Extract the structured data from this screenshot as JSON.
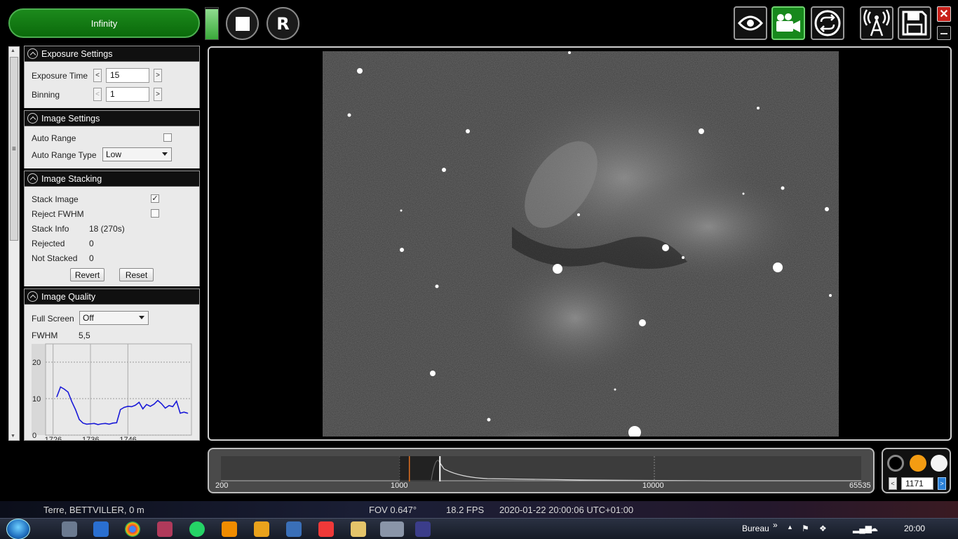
{
  "toolbar": {
    "profile_label": "Infinity",
    "record_label": "R",
    "signal_level": 0.95
  },
  "exposure": {
    "title": "Exposure Settings",
    "exposure_time_label": "Exposure Time",
    "exposure_time_value": "15",
    "binning_label": "Binning",
    "binning_value": "1",
    "decrement": "<",
    "increment": ">"
  },
  "image_settings": {
    "title": "Image Settings",
    "auto_range_label": "Auto Range",
    "auto_range_checked": false,
    "auto_range_type_label": "Auto Range Type",
    "auto_range_type_value": "Low"
  },
  "stacking": {
    "title": "Image Stacking",
    "stack_image_label": "Stack Image",
    "stack_image_checked": true,
    "reject_fwhm_label": "Reject FWHM",
    "reject_fwhm_checked": false,
    "stack_info_label": "Stack Info",
    "stack_info_value": "18 (270s)",
    "rejected_label": "Rejected",
    "rejected_value": "0",
    "not_stacked_label": "Not Stacked",
    "not_stacked_value": "0",
    "revert_label": "Revert",
    "reset_label": "Reset"
  },
  "quality": {
    "title": "Image Quality",
    "full_screen_label": "Full Screen",
    "full_screen_value": "Off",
    "fwhm_label": "FWHM",
    "fwhm_value": "5,5"
  },
  "chart_data": {
    "type": "line",
    "title": "",
    "xlabel": "",
    "ylabel": "",
    "ylim": [
      0,
      25
    ],
    "yticks": [
      "0",
      "10",
      "20"
    ],
    "xticks": [
      "1726",
      "1736",
      "1746"
    ],
    "x": [
      1727,
      1728,
      1729,
      1730,
      1731,
      1732,
      1733,
      1734,
      1735,
      1736,
      1737,
      1738,
      1739,
      1740,
      1741,
      1742,
      1743,
      1744,
      1745,
      1746,
      1747,
      1748,
      1749,
      1750,
      1751,
      1752,
      1753,
      1754,
      1755,
      1756,
      1757,
      1758,
      1759,
      1760,
      1761,
      1762
    ],
    "series": [
      {
        "values": [
          10.5,
          13.2,
          12.6,
          11.8,
          9.2,
          7,
          4.3,
          3.3,
          3,
          3.1,
          3.2,
          2.9,
          3.1,
          3.2,
          3,
          3.3,
          3.4,
          7,
          7.6,
          7.9,
          7.8,
          8.2,
          9,
          7.2,
          8.4,
          7.9,
          8.5,
          9.5,
          8.6,
          7.4,
          8.1,
          7.8,
          9.3,
          6,
          6.3,
          6
        ],
        "color": "#1a1ad8"
      }
    ],
    "grid": true
  },
  "histogram": {
    "min_label": "200",
    "tick_1000": "1000",
    "tick_10000": "10000",
    "max_label": "65535",
    "black_point": 1100,
    "white_point": 1450
  },
  "color_panel": {
    "prev_label": "<",
    "next_label": ">",
    "frame_value": "1171"
  },
  "status": {
    "location": "Terre, BETTVILLER, 0 m",
    "fov": "FOV 0.647°",
    "fps": "18.2 FPS",
    "datetime": "2020-01-22 20:00:06 UTC+01:00"
  },
  "taskbar": {
    "bureau_label": "Bureau",
    "chevron": "»",
    "clock": "20:00"
  }
}
